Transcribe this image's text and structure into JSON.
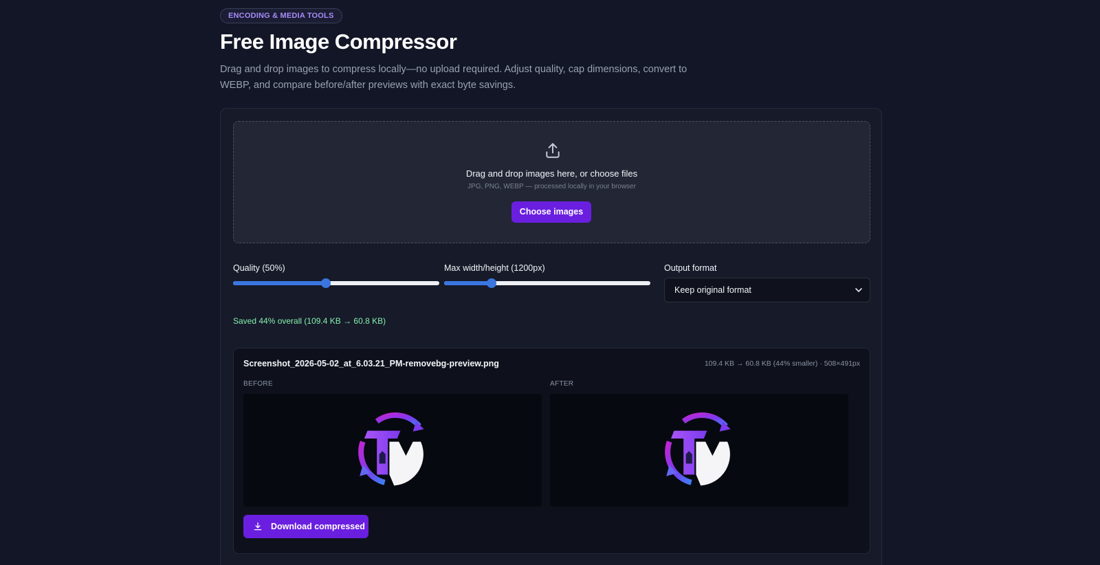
{
  "header": {
    "tag": "ENCODING & MEDIA TOOLS",
    "title": "Free Image Compressor",
    "description": "Drag and drop images to compress locally—no upload required. Adjust quality, cap dimensions, convert to WEBP, and compare before/after previews with exact byte savings."
  },
  "dropzone": {
    "icon": "upload-icon",
    "title": "Drag and drop images here, or choose files",
    "subtitle": "JPG, PNG, WEBP — processed locally in your browser",
    "button_label": "Choose images"
  },
  "controls": {
    "quality": {
      "label": "Quality (50%)",
      "value_fraction": 0.45
    },
    "max_dimension": {
      "label": "Max width/height (1200px)",
      "value_fraction": 0.23
    },
    "output_format": {
      "label": "Output format",
      "selected": "Keep original format"
    }
  },
  "summary": "Saved 44% overall (109.4 KB → 60.8 KB)",
  "result": {
    "filename": "Screenshot_2026-05-02_at_6.03.21_PM-removebg-preview.png",
    "meta": "109.4 KB → 60.8 KB (44% smaller) · 508×491px",
    "before_label": "BEFORE",
    "after_label": "AFTER",
    "download_label": "Download compressed"
  },
  "colors": {
    "accent": "#6a1fe0",
    "slider": "#3b76e0",
    "success": "#86efac"
  }
}
